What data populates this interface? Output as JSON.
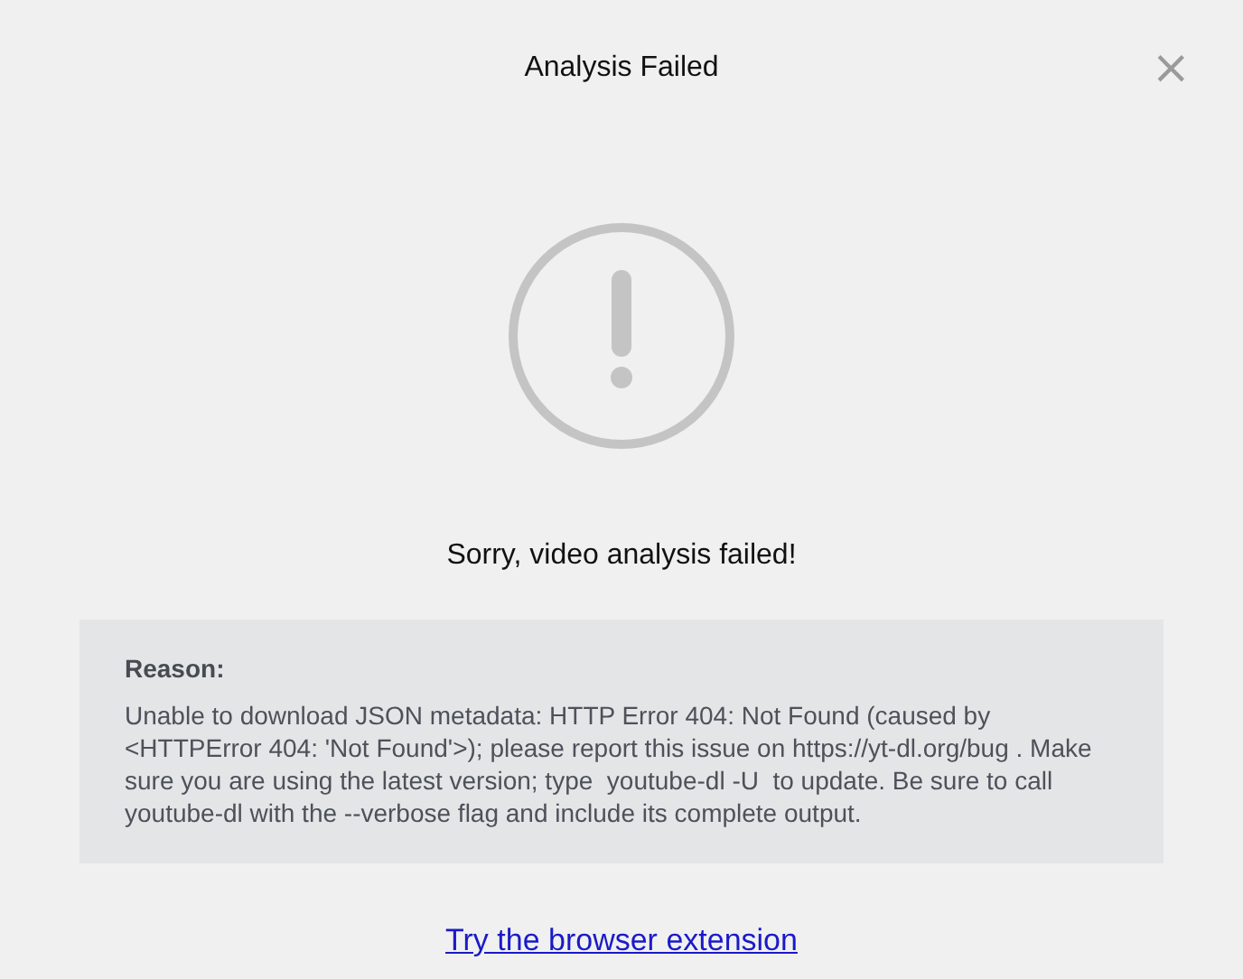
{
  "dialog": {
    "title": "Analysis Failed",
    "close": "×"
  },
  "message": "Sorry, video analysis failed!",
  "reason": {
    "heading": "Reason:",
    "text": "Unable to download JSON metadata: HTTP Error 404: Not Found (caused by <HTTPError 404: 'Not Found'>); please report this issue on https://yt-dl.org/bug . Make sure you are using the latest version; type  youtube-dl -U  to update. Be sure to call youtube-dl with the --verbose flag and include its complete output."
  },
  "link": "Try the browser extension"
}
